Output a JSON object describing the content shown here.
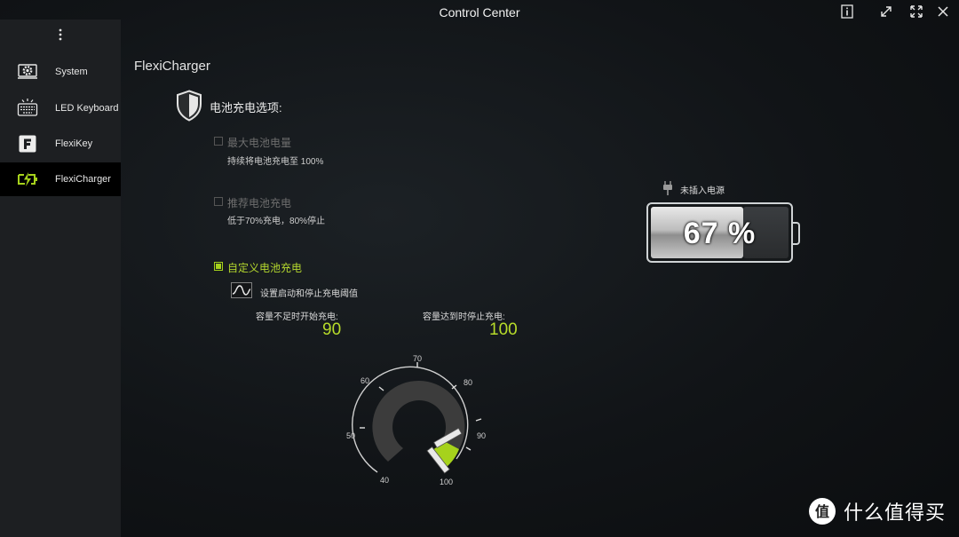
{
  "window": {
    "title": "Control Center",
    "buttons": [
      "info-icon",
      "restore-icon",
      "fullscreen-icon",
      "close-icon"
    ]
  },
  "sidebar": {
    "items": [
      {
        "label": "System",
        "icon": "gear-icon",
        "active": false
      },
      {
        "label": "LED Keyboard",
        "icon": "keyboard-icon",
        "active": false
      },
      {
        "label": "FlexiKey",
        "icon": "flexikey-icon",
        "active": false
      },
      {
        "label": "FlexiCharger",
        "icon": "battery-charge-icon",
        "active": true
      }
    ]
  },
  "main": {
    "section_title": "FlexiCharger",
    "options_title": "电池充电选项:",
    "options": [
      {
        "label": "最大电池电量",
        "desc": "持续将电池充电至 100%",
        "checked": false
      },
      {
        "label": "推荐电池充电",
        "desc": "低于70%充电，80%停止",
        "checked": false
      },
      {
        "label": "自定义电池充电",
        "checked": true
      }
    ],
    "threshold": {
      "desc": "设置启动和停止充电阈值",
      "start_label": "容量不足时开始充电:",
      "start_value": "90",
      "stop_label": "容量达到时停止充电:",
      "stop_value": "100",
      "gauge_ticks": [
        "40",
        "50",
        "60",
        "70",
        "80",
        "90",
        "100"
      ]
    }
  },
  "battery": {
    "status": "未插入电源",
    "percent_text": "67 %",
    "level": 0.67
  },
  "watermark": {
    "text": "什么值得买",
    "badge": "值"
  },
  "colors": {
    "accent": "#a6d21c",
    "sidebar_bg": "#1d1f22",
    "active_bg": "#000000"
  }
}
